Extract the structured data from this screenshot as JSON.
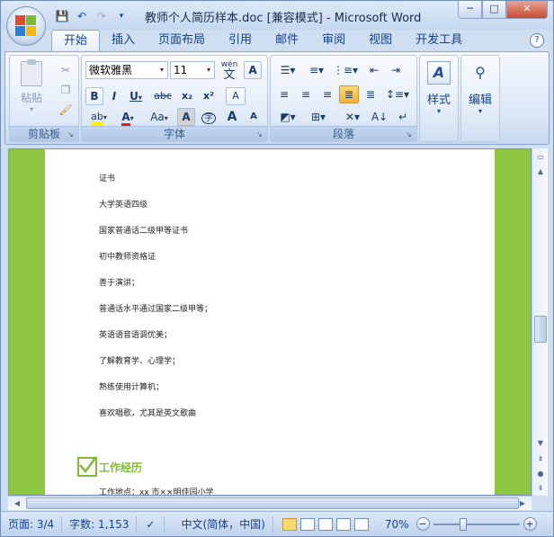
{
  "window": {
    "title": "教师个人简历样本.doc [兼容模式] - Microsoft Word",
    "controls": {
      "minimize": "─",
      "maximize": "□",
      "close": "✕"
    }
  },
  "quick_access": {
    "save_icon": "save-icon",
    "undo_icon": "undo-icon",
    "redo_icon": "redo-icon",
    "customize_icon": "customize-icon"
  },
  "tabs": [
    {
      "label": "开始",
      "active": true
    },
    {
      "label": "插入"
    },
    {
      "label": "页面布局"
    },
    {
      "label": "引用"
    },
    {
      "label": "邮件"
    },
    {
      "label": "审阅"
    },
    {
      "label": "视图"
    },
    {
      "label": "开发工具"
    }
  ],
  "ribbon": {
    "clipboard": {
      "label": "剪贴板",
      "paste": "粘贴"
    },
    "font": {
      "label": "字体",
      "font_name": "微软雅黑",
      "font_size": "11",
      "wen": "wén",
      "wen_char": "文",
      "a_box": "A",
      "bold": "B",
      "italic": "I",
      "underline": "U",
      "strike": "abc",
      "subscript": "x₂",
      "superscript": "x²",
      "clear": "A",
      "highlight": "ab",
      "font_color": "A",
      "change_case": "Aa",
      "char_shading": "A",
      "enclosed": "字",
      "grow": "A",
      "shrink": "A"
    },
    "paragraph": {
      "label": "段落"
    },
    "styles": {
      "label": "样式"
    },
    "editing": {
      "label": "编辑"
    }
  },
  "document": {
    "lines": [
      "证书",
      "大学英语四级",
      "国家普通话二级甲等证书",
      "初中教师资格证",
      "善于演讲；",
      "普通话水平通过国家二级甲等；",
      "英语语音语调优美；",
      "了解教育学、心理学；",
      "熟练使用计算机；",
      "喜欢唱歌，尤其是英文歌曲"
    ],
    "section_title": "工作经历",
    "last_line": "工作地点：xx 市××明佳园小学"
  },
  "status": {
    "page": "页面: 3/4",
    "words": "字数: 1,153",
    "language": "中文(简体，中国)",
    "zoom": "70%",
    "zoom_level": 0.7
  },
  "colors": {
    "accent_green": "#8dc63f",
    "heading_green": "#7dbb35",
    "ribbon_text": "#15428b"
  }
}
